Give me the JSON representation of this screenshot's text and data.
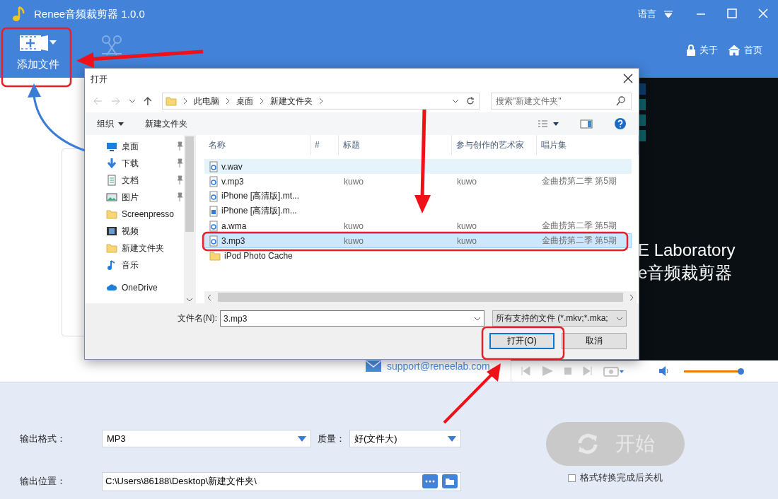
{
  "window": {
    "title": "Renee音频裁剪器 1.0.0",
    "language": "语言"
  },
  "toolbar": {
    "add_file": "添加文件",
    "about": "关于",
    "home": "首页"
  },
  "preview": {
    "banner_lines": [
      "E Laboratory",
      "e音频裁剪器"
    ],
    "volume": {
      "level": 0.95
    }
  },
  "support": {
    "email": "support@reneelab.com"
  },
  "settings": {
    "format_label": "输出格式：",
    "format": "MP3",
    "quality_label": "质量：",
    "quality": "好(文件大)",
    "location_label": "输出位置：",
    "location": "C:\\Users\\86188\\Desktop\\新建文件夹\\",
    "start": "开始",
    "start_disabled": true,
    "shutdown": {
      "label": "格式转换完成后关机",
      "checked": false
    }
  },
  "dialog": {
    "title": "打开",
    "breadcrumbs": [
      "此电脑",
      "桌面",
      "新建文件夹"
    ],
    "search": {
      "placeholder": "搜索\"新建文件夹\""
    },
    "commands": [
      "组织",
      "新建文件夹"
    ],
    "nav_items": [
      {
        "label": "桌面",
        "kind": "desktop",
        "pinned": true
      },
      {
        "label": "下载",
        "kind": "download",
        "pinned": true
      },
      {
        "label": "文档",
        "kind": "document",
        "pinned": true
      },
      {
        "label": "图片",
        "kind": "picture",
        "pinned": true
      },
      {
        "label": "Screenpresso",
        "kind": "folder",
        "pinned": false
      },
      {
        "label": "视频",
        "kind": "video",
        "pinned": false
      },
      {
        "label": "新建文件夹",
        "kind": "folder",
        "pinned": false
      },
      {
        "label": "音乐",
        "kind": "music",
        "pinned": false
      },
      {
        "label": "OneDrive",
        "kind": "cloud",
        "pinned": false
      }
    ],
    "columns": [
      "名称",
      "#",
      "标题",
      "参与创作的艺术家",
      "唱片集"
    ],
    "files": [
      {
        "name": "v.wav",
        "kind": "audio",
        "hovered": true,
        "selected": false
      },
      {
        "name": "v.mp3",
        "kind": "audio",
        "title": "kuwo",
        "artist": "kuwo",
        "album": "金曲捞第二季 第5期",
        "hovered": false,
        "selected": false
      },
      {
        "name": "iPhone [高清版].mt...",
        "kind": "audio",
        "hovered": false,
        "selected": false
      },
      {
        "name": "iPhone [高清版].m...",
        "kind": "video",
        "hovered": false,
        "selected": false
      },
      {
        "name": "a.wma",
        "kind": "audio",
        "title": "kuwo",
        "artist": "kuwo",
        "album": "金曲捞第二季 第5期",
        "hovered": false,
        "selected": false
      },
      {
        "name": "3.mp3",
        "kind": "audio",
        "title": "kuwo",
        "artist": "kuwo",
        "album": "金曲捞第二季 第5期",
        "hovered": false,
        "selected": true
      },
      {
        "name": "iPod Photo Cache",
        "kind": "folder",
        "hovered": false,
        "selected": false
      }
    ],
    "filename_label": "文件名(N):",
    "filename": "3.mp3",
    "filter": "所有支持的文件 (*.mkv;*.mka;",
    "open": "打开(O)",
    "cancel": "取消"
  }
}
